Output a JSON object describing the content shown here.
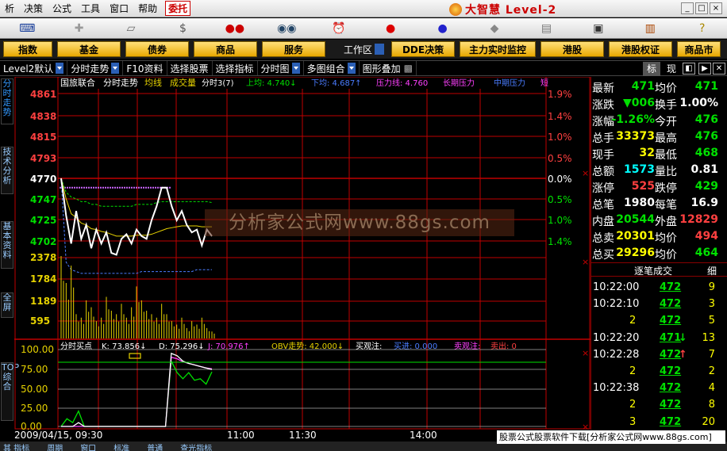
{
  "menu": {
    "items": [
      "析",
      "决策",
      "公式",
      "工具",
      "窗口",
      "帮助"
    ],
    "entrust": "委托",
    "brand": "大智慧 Level-2"
  },
  "toolbar": {
    "icons": [
      "keyboard-icon",
      "add-icon",
      "ruler-icon",
      "dollar-icon",
      "traffic-light-icon",
      "binoculars-icon",
      "alarm-icon",
      "red-ball-icon",
      "blue-ball-icon",
      "diamond-icon",
      "calendar-icon",
      "window-icon",
      "books-icon",
      "help-icon"
    ]
  },
  "nav": {
    "buttons": [
      "指数",
      "基金",
      "债券",
      "商品",
      "服务"
    ],
    "workspace": "工作区",
    "dde": "DDE决策",
    "monitor": "主力实时监控",
    "hk": "港股",
    "hkwarrant": "港股权证",
    "comm": "商品市"
  },
  "sub": {
    "items": [
      "Level2默认",
      "分时走势",
      "F10资料",
      "选择股票",
      "选择指标",
      "分时图",
      "多图组合",
      "图形叠加"
    ],
    "tag_biao": "标",
    "tag_xian": "现"
  },
  "left_tabs": [
    "分时走势",
    "技术分析",
    "基本资料",
    "全屏",
    "TOP综合"
  ],
  "chart": {
    "header": {
      "name": "国旅联合",
      "mode": "分时走势",
      "avg": "均线",
      "vol": "成交量",
      "m3": "分时3(7)",
      "up": "上均: 4.740↓",
      "down": "下均: 4.687↑",
      "press": "压力线: 4.760",
      "long": "长期压力",
      "mid": "中期压力",
      "last": "短"
    },
    "price_labels": [
      "4861",
      "4838",
      "4815",
      "4793",
      "4770",
      "4747",
      "4725",
      "4702"
    ],
    "pct_labels": [
      "1.9%",
      "1.4%",
      "1.0%",
      "0.5%",
      "0.0%",
      "0.5%",
      "1.0%",
      "1.4%"
    ],
    "vol_labels": [
      "2378",
      "1784",
      "1189",
      "595"
    ],
    "ind_labels": [
      "100.00",
      "75.00",
      "50.00",
      "25.00",
      "0.00"
    ],
    "ind_header": {
      "name": "分时买点",
      "k": "K: 73.856↓",
      "d": "D: 75.296↓",
      "j": "J: 70.976↑",
      "obv": "OBV走势: 42.000↓",
      "buy": "买观注:",
      "buyv": "买进: 0.000",
      "sell": "卖观注:",
      "sellv": "卖出: 0"
    },
    "time_labels": [
      "2009/04/15, 09:30",
      "11:00",
      "11:30",
      "14:00"
    ],
    "colors": {
      "grid": "#c00000",
      "price": "#ffffff",
      "avg": "#e6d200",
      "green": "#00e000",
      "magenta": "#ff40ff",
      "volume": "#e6d200"
    }
  },
  "chart_data": {
    "type": "line",
    "price": [
      4770,
      4730,
      4700,
      4735,
      4705,
      4720,
      4695,
      4715,
      4700,
      4712,
      4690,
      4688,
      4705,
      4710,
      4700,
      4715,
      4708,
      4705,
      4725,
      4740,
      4760,
      4760,
      4740,
      4725,
      4735,
      4720,
      4712,
      4715,
      4698,
      4715,
      4708
    ],
    "avg": [
      4770,
      4748,
      4732,
      4728,
      4722,
      4720,
      4716,
      4715,
      4713,
      4712,
      4710,
      4708,
      4708,
      4708,
      4708,
      4709,
      4709,
      4709,
      4710,
      4712,
      4714,
      4716,
      4717,
      4718,
      4719,
      4719,
      4719,
      4719,
      4718,
      4718,
      4718
    ],
    "upper_band": [
      4770,
      4755,
      4750,
      4748,
      4745,
      4745,
      4742,
      4742,
      4740,
      4740,
      4740,
      4740,
      4740,
      4740,
      4740,
      4742,
      4742,
      4742,
      4742,
      4744,
      4745,
      4745,
      4745,
      4745,
      4745,
      4745,
      4745,
      4745,
      4745,
      4745,
      4744
    ],
    "lower_band": [
      4770,
      4680,
      4672,
      4670,
      4668,
      4668,
      4668,
      4668,
      4668,
      4668,
      4668,
      4668,
      4668,
      4668,
      4668,
      4668,
      4670,
      4670,
      4670,
      4670,
      4670,
      4670,
      4670,
      4670,
      4670,
      4670,
      4670,
      4672,
      4672,
      4672,
      4672
    ],
    "press_line": 4760,
    "volume": [
      2378,
      1600,
      2100,
      700,
      600,
      1100,
      900,
      500,
      600,
      1200,
      800,
      700,
      1000,
      600,
      900,
      1500,
      1100,
      800,
      700,
      600,
      1000,
      700,
      500,
      400,
      600,
      300,
      500,
      400,
      600,
      300,
      200
    ],
    "k": [
      0,
      0,
      0,
      5,
      0,
      0,
      0,
      0,
      0,
      0,
      0,
      0,
      0,
      0,
      0,
      0,
      0,
      0,
      0,
      95,
      92,
      85,
      82,
      80,
      78,
      76,
      74
    ],
    "d": [
      0,
      0,
      0,
      0,
      0,
      0,
      0,
      0,
      0,
      0,
      0,
      0,
      0,
      0,
      0,
      0,
      0,
      0,
      0,
      90,
      88,
      84,
      82,
      80,
      78,
      76,
      75
    ],
    "j": [
      0,
      10,
      5,
      20,
      0,
      0,
      0,
      0,
      0,
      0,
      0,
      0,
      0,
      0,
      0,
      0,
      0,
      0,
      0,
      85,
      70,
      62,
      70,
      60,
      62,
      55,
      71
    ],
    "obv": [
      0,
      0,
      0,
      0,
      0,
      0,
      0,
      0,
      0,
      0,
      0,
      0,
      0,
      0,
      0,
      0,
      0,
      0,
      0,
      0,
      0,
      0,
      0,
      0,
      0,
      0,
      42
    ]
  },
  "quote": {
    "rows": [
      {
        "l": "最新",
        "v": "471",
        "r": "均价",
        "rv": "471",
        "vc": "#00e000",
        "rc": "#00e000"
      },
      {
        "l": "涨跌",
        "v": "▼006",
        "r": "换手",
        "rv": "1.00%",
        "vc": "#00e000",
        "rc": "#fff"
      },
      {
        "l": "涨幅",
        "v": "-1.26%",
        "r": "今开",
        "rv": "476",
        "vc": "#00e000",
        "rc": "#00e000"
      },
      {
        "l": "总手",
        "v": "33373",
        "r": "最高",
        "rv": "476",
        "vc": "#ffff00",
        "rc": "#00e000"
      },
      {
        "l": "现手",
        "v": "32",
        "r": "最低",
        "rv": "468",
        "vc": "#ffff00",
        "rc": "#00e000"
      },
      {
        "l": "总额",
        "v": "1573",
        "r": "量比",
        "rv": "0.81",
        "vc": "#00ffff",
        "rc": "#fff"
      },
      {
        "l": "涨停",
        "v": "525",
        "r": "跌停",
        "rv": "429",
        "vc": "#ff4040",
        "rc": "#00e000"
      },
      {
        "l": "总笔",
        "v": "1980",
        "r": "每笔",
        "rv": "16.9",
        "vc": "#fff",
        "rc": "#fff"
      },
      {
        "l": "内盘",
        "v": "20544",
        "r": "外盘",
        "rv": "12829",
        "vc": "#00e000",
        "rc": "#ff4040"
      },
      {
        "l": "总卖",
        "v": "20301",
        "r": "均价",
        "rv": "494",
        "vc": "#ffff00",
        "rc": "#ff4040"
      },
      {
        "l": "总买",
        "v": "29296",
        "r": "均价",
        "rv": "464",
        "vc": "#ffff00",
        "rc": "#00e000"
      }
    ],
    "ticks_title": "逐笔成交",
    "ticks_detail": "细",
    "ticks": [
      {
        "t": "10:22:00",
        "p": "472",
        "v": "9",
        "a": ""
      },
      {
        "t": "10:22:10",
        "p": "472",
        "v": "3",
        "a": ""
      },
      {
        "t": "",
        "p": "472",
        "v": "5",
        "a": "2"
      },
      {
        "t": "10:22:20",
        "p": "471",
        "v": "13",
        "a": "↓"
      },
      {
        "t": "10:22:28",
        "p": "472",
        "v": "7",
        "a": "↑"
      },
      {
        "t": "",
        "p": "472",
        "v": "2",
        "a": "2"
      },
      {
        "t": "10:22:38",
        "p": "472",
        "v": "4",
        "a": ""
      },
      {
        "t": "",
        "p": "472",
        "v": "8",
        "a": "2"
      },
      {
        "t": "",
        "p": "472",
        "v": "20",
        "a": "3"
      }
    ]
  },
  "watermark": "分析家公式网www.88gs.com",
  "footnote": "股票公式股票软件下载[分析家公式网www.88gs.com]",
  "bottom_tabs": [
    "其 指标",
    "周期",
    "窗口",
    "标准",
    "普通",
    "查光指标"
  ]
}
